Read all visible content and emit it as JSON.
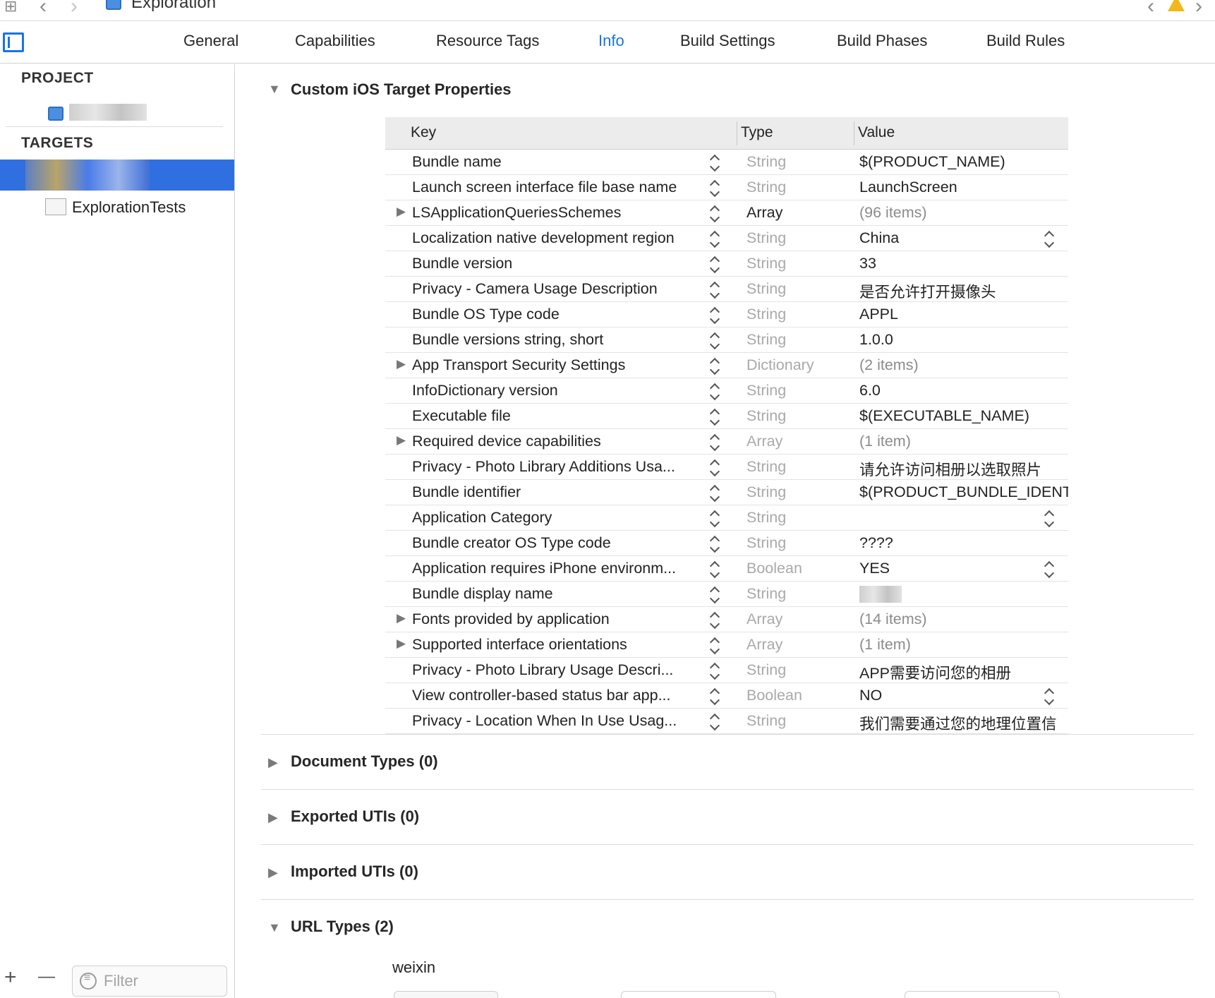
{
  "toolbar": {
    "title": "Exploration",
    "grid_icon": "grid-icon",
    "back_icon": "chevron-left-icon",
    "forward_icon": "chevron-right-icon",
    "warning_icon": "warning-icon"
  },
  "tabs": [
    {
      "label": "General"
    },
    {
      "label": "Capabilities"
    },
    {
      "label": "Resource Tags"
    },
    {
      "label": "Info",
      "active": true
    },
    {
      "label": "Build Settings"
    },
    {
      "label": "Build Phases"
    },
    {
      "label": "Build Rules"
    }
  ],
  "sidebar": {
    "project_header": "PROJECT",
    "targets_header": "TARGETS",
    "test_target": "ExplorationTests",
    "filter_placeholder": "Filter",
    "add_label": "+",
    "remove_label": "—"
  },
  "sections": {
    "custom": "Custom iOS Target Properties",
    "document_types": "Document Types (0)",
    "exported_utis": "Exported UTIs (0)",
    "imported_utis": "Imported UTIs (0)",
    "url_types": "URL Types (2)"
  },
  "plist": {
    "headers": {
      "key": "Key",
      "type": "Type",
      "value": "Value"
    },
    "rows": [
      {
        "key": "Bundle name",
        "type": "String",
        "value": "$(PRODUCT_NAME)"
      },
      {
        "key": "Launch screen interface file base name",
        "type": "String",
        "value": "LaunchScreen"
      },
      {
        "key": "LSApplicationQueriesSchemes",
        "type": "Array",
        "value": "(96 items)",
        "expandable": true
      },
      {
        "key": "Localization native development region",
        "type": "String",
        "value": "China",
        "popup": true
      },
      {
        "key": "Bundle version",
        "type": "String",
        "value": "33"
      },
      {
        "key": "Privacy - Camera Usage Description",
        "type": "String",
        "value": "是否允许打开摄像头"
      },
      {
        "key": "Bundle OS Type code",
        "type": "String",
        "value": "APPL"
      },
      {
        "key": "Bundle versions string, short",
        "type": "String",
        "value": "1.0.0"
      },
      {
        "key": "App Transport Security Settings",
        "type": "Dictionary",
        "value": "(2 items)",
        "expandable": true
      },
      {
        "key": "InfoDictionary version",
        "type": "String",
        "value": "6.0"
      },
      {
        "key": "Executable file",
        "type": "String",
        "value": "$(EXECUTABLE_NAME)"
      },
      {
        "key": "Required device capabilities",
        "type": "Array",
        "value": "(1 item)",
        "expandable": true
      },
      {
        "key": "Privacy - Photo Library Additions Usa...",
        "type": "String",
        "value": "请允许访问相册以选取照片"
      },
      {
        "key": "Bundle identifier",
        "type": "String",
        "value": "$(PRODUCT_BUNDLE_IDENT"
      },
      {
        "key": "Application Category",
        "type": "String",
        "value": "",
        "popup": true
      },
      {
        "key": "Bundle creator OS Type code",
        "type": "String",
        "value": "????"
      },
      {
        "key": "Application requires iPhone environm...",
        "type": "Boolean",
        "value": "YES",
        "popup": true
      },
      {
        "key": "Bundle display name",
        "type": "String",
        "value": ""
      },
      {
        "key": "Fonts provided by application",
        "type": "Array",
        "value": "(14 items)",
        "expandable": true
      },
      {
        "key": "Supported interface orientations",
        "type": "Array",
        "value": "(1 item)",
        "expandable": true
      },
      {
        "key": "Privacy - Photo Library Usage Descri...",
        "type": "String",
        "value": "APP需要访问您的相册"
      },
      {
        "key": "View controller-based status bar app...",
        "type": "Boolean",
        "value": "NO",
        "popup": true
      },
      {
        "key": "Privacy - Location When In Use Usag...",
        "type": "String",
        "value": "我们需要通过您的地理位置信"
      }
    ]
  },
  "url_types": {
    "first_identifier": "weixin"
  }
}
